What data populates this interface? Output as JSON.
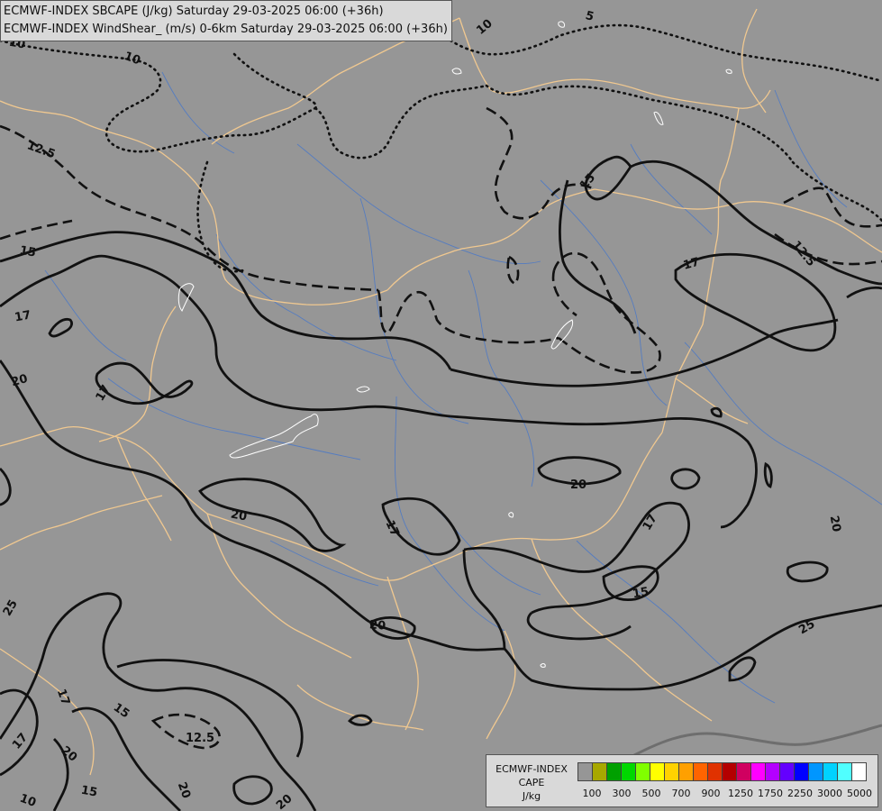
{
  "title": {
    "line1": "ECMWF-INDEX SBCAPE (J/kg) Saturday 29-03-2025 06:00 (+36h)",
    "line2": "ECMWF-INDEX WindShear_ (m/s) 0-6km Saturday 29-03-2025 06:00 (+36h)"
  },
  "legend": {
    "line1": "ECMWF-INDEX",
    "line2": "CAPE",
    "line3": "J/kg",
    "colors": [
      "#969696",
      "#a8a800",
      "#00a000",
      "#00d800",
      "#80ff00",
      "#ffff00",
      "#ffd200",
      "#ffa000",
      "#ff6400",
      "#e03200",
      "#b40000",
      "#d00060",
      "#ff00ff",
      "#b400ff",
      "#6400ff",
      "#0000ff",
      "#0096ff",
      "#00d2ff",
      "#50ffff",
      "#ffffff"
    ],
    "ticks": [
      "100",
      "300",
      "500",
      "700",
      "900",
      "1250",
      "1750",
      "2250",
      "3000",
      "5000"
    ]
  },
  "contour_labels": {
    "l1": "10",
    "l2": "5",
    "l3": "10",
    "l4": "10",
    "l5": "12.5",
    "l6": "15",
    "l7": "17",
    "l8": "20",
    "l9": "17",
    "l10": "15",
    "l11": "17",
    "l12": "12.5",
    "l13": "20",
    "l14": "20",
    "l15": "17",
    "l16": "17",
    "l17": "20",
    "l18": "15",
    "l19": "20",
    "l20": "25",
    "l21": "25",
    "l22": "17",
    "l23": "15",
    "l24": "12.5",
    "l25": "17",
    "l26": "20",
    "l27": "15",
    "l28": "20",
    "l29": "20",
    "l30": "10"
  }
}
